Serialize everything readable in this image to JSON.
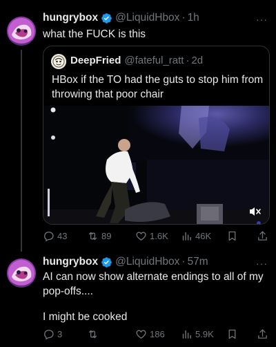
{
  "tweet1": {
    "name": "hungrybox",
    "handle": "@LiquidHbox",
    "dot": "·",
    "time": "1h",
    "text": "what the FUCK is this",
    "more": "···",
    "quoted": {
      "name": "DeepFried",
      "handle": "@fateful_ratt",
      "dot": "·",
      "time": "2d",
      "text": "HBox if the TO had the guts to stop him from throwing that poor chair"
    },
    "stats": {
      "replies": "43",
      "retweets": "89",
      "likes": "1.6K",
      "views": "46K"
    }
  },
  "tweet2": {
    "name": "hungrybox",
    "handle": "@LiquidHbox",
    "dot": "·",
    "time": "57m",
    "more": "···",
    "text_line1": "AI can now show alternate endings to all of my pop-offs....",
    "text_line2": "I might be cooked",
    "stats": {
      "replies": "3",
      "retweets": "",
      "likes": "186",
      "views": "5.9K"
    }
  },
  "icons": {
    "verified": "verified-badge-icon",
    "reply": "reply-icon",
    "retweet": "retweet-icon",
    "like": "heart-icon",
    "views": "views-icon",
    "bookmark": "bookmark-icon",
    "share": "share-icon",
    "mute": "muted-speaker-icon"
  },
  "colors": {
    "background": "#000000",
    "text": "#e7e9ea",
    "muted": "#71767b",
    "verified": "#1d9bf0",
    "border": "#2f3336"
  }
}
